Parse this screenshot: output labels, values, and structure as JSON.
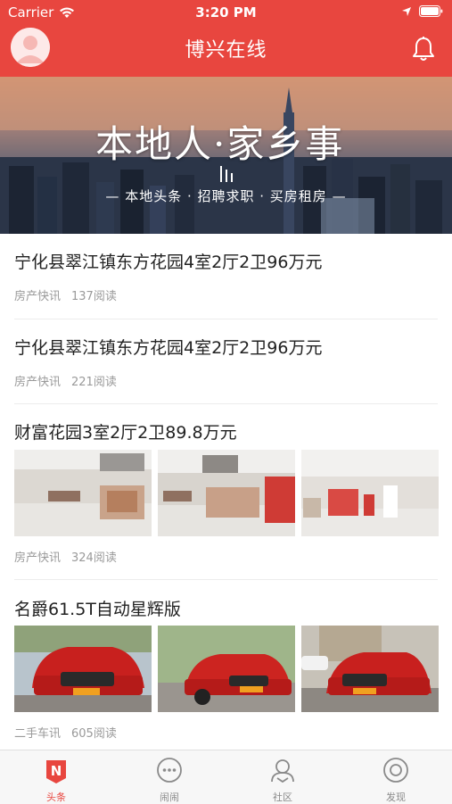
{
  "status_bar": {
    "carrier": "Carrier",
    "time": "3:20 PM"
  },
  "nav": {
    "title": "博兴在线",
    "avatar_icon": "avatar-icon",
    "bell_icon": "bell-icon"
  },
  "banner": {
    "headline": "本地人·家乡事",
    "subtitle": "— 本地头条 · 招聘求职 · 买房租房 —"
  },
  "news": [
    {
      "title": "宁化县翠江镇东方花园4室2厅2卫96万元",
      "category": "房产快讯",
      "reads": "137阅读"
    },
    {
      "title": "宁化县翠江镇东方花园4室2厅2卫96万元",
      "category": "房产快讯",
      "reads": "221阅读"
    },
    {
      "title": "财富花园3室2厅2卫89.8万元",
      "category": "房产快讯",
      "reads": "324阅读"
    },
    {
      "title": "名爵61.5T自动星辉版",
      "category": "二手车讯",
      "reads": "605阅读"
    }
  ],
  "tabs": [
    {
      "label": "头条",
      "icon": "headline-icon",
      "active": true
    },
    {
      "label": "闹闹",
      "icon": "chat-icon",
      "active": false
    },
    {
      "label": "社区",
      "icon": "community-icon",
      "active": false
    },
    {
      "label": "发现",
      "icon": "discover-icon",
      "active": false
    }
  ],
  "colors": {
    "accent": "#e8463f",
    "meta_text": "#9a9a9a",
    "title_text": "#222222"
  }
}
